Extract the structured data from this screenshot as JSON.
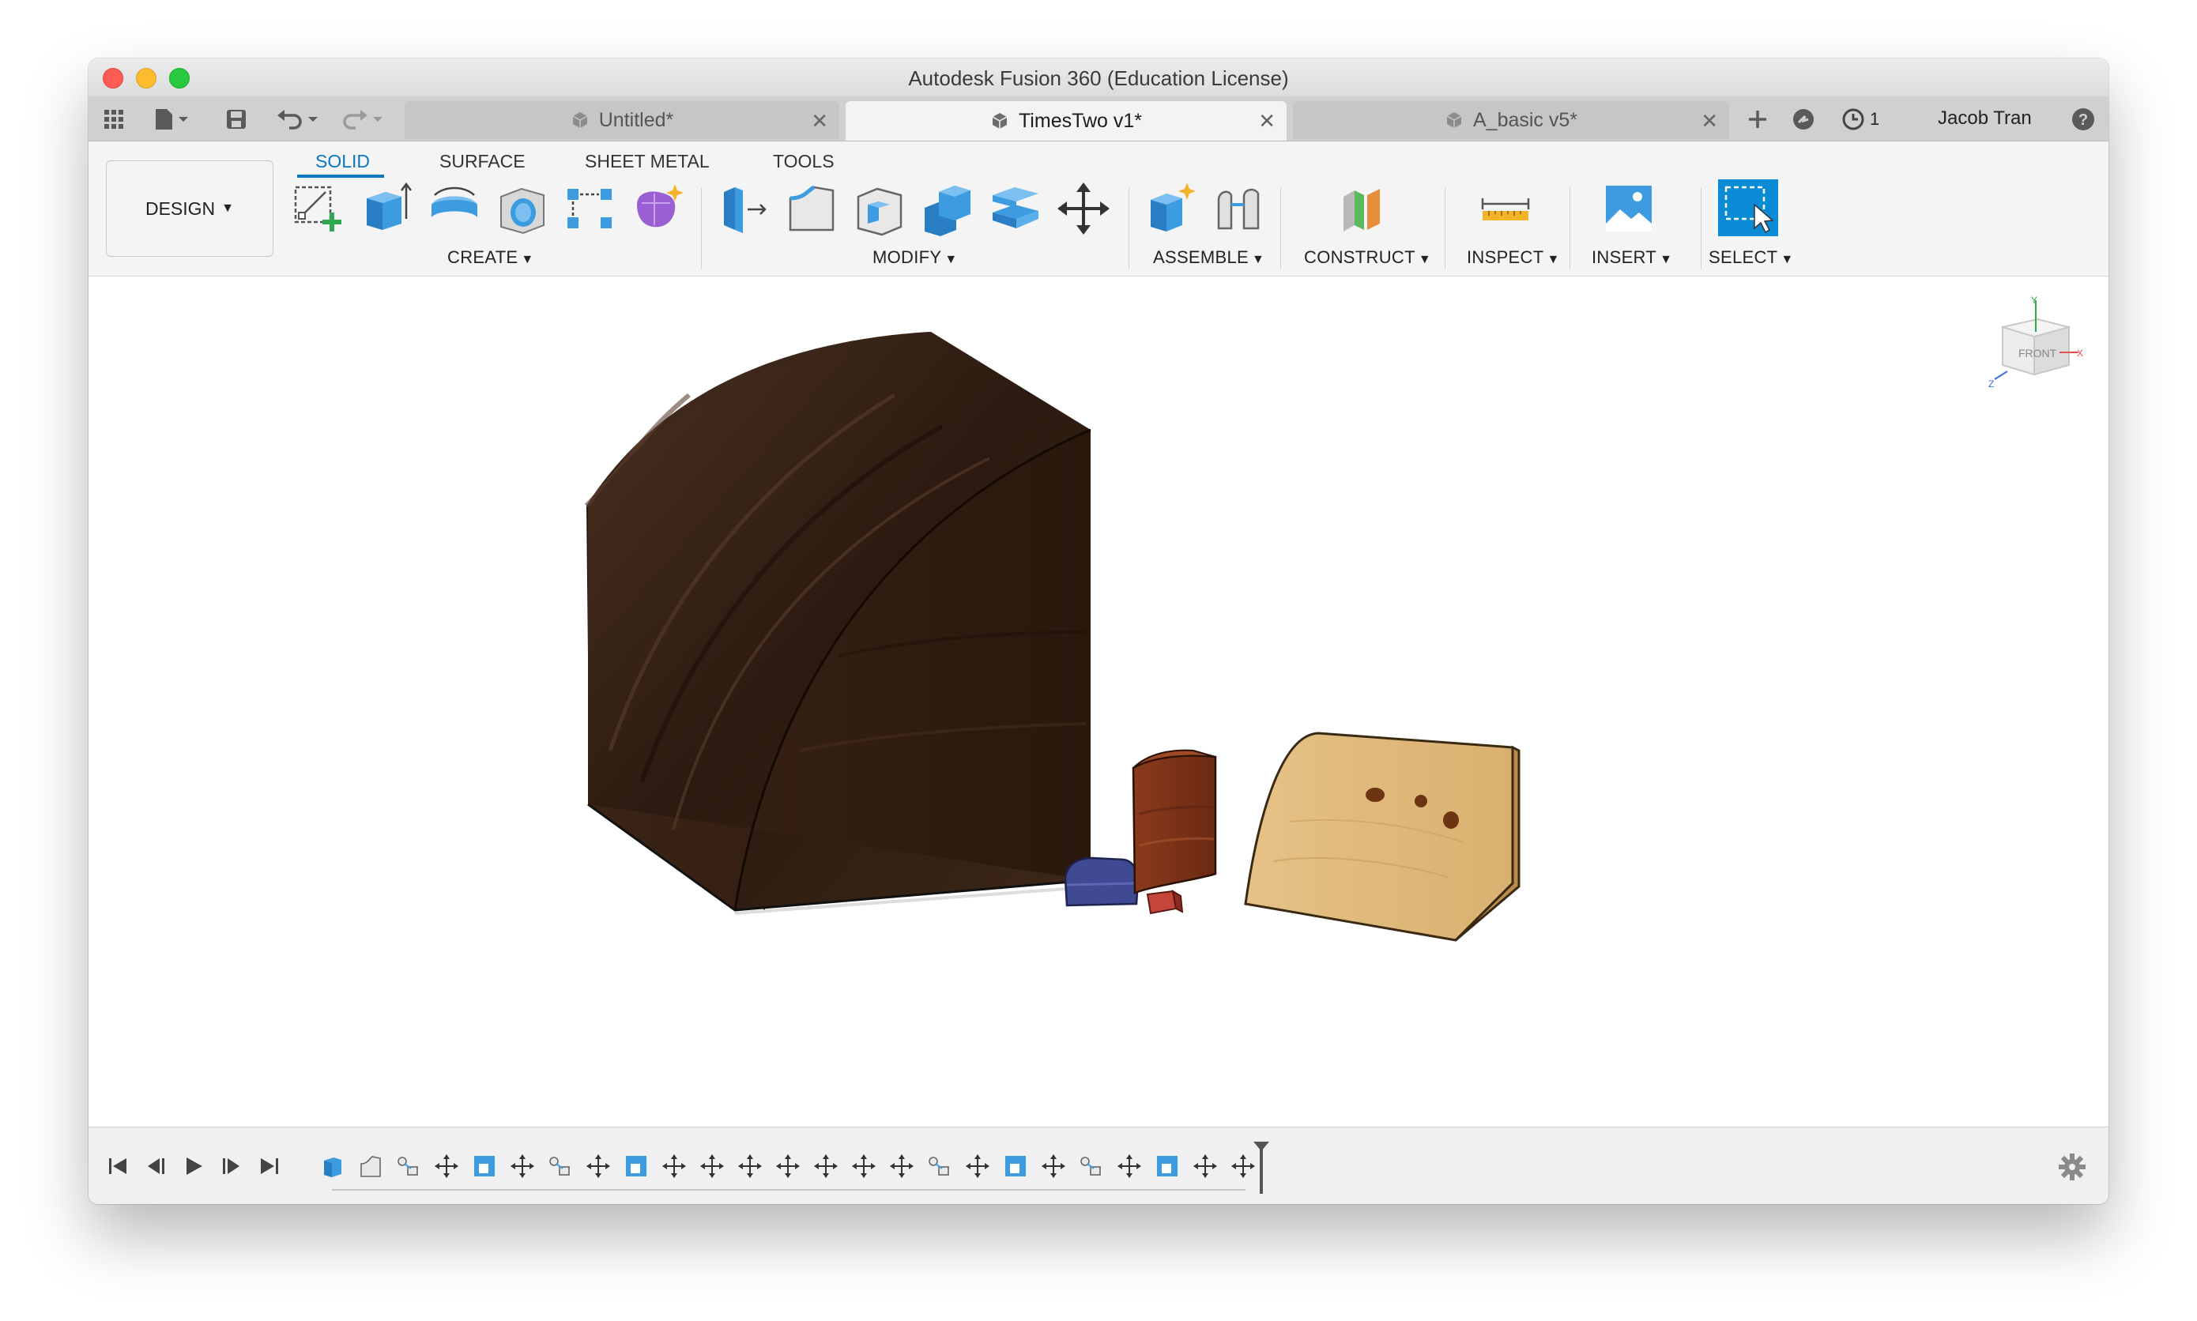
{
  "window": {
    "title": "Autodesk Fusion 360 (Education License)"
  },
  "tabs": [
    {
      "label": "Untitled*",
      "active": false
    },
    {
      "label": "TimesTwo v1*",
      "active": true
    },
    {
      "label": "A_basic v5*",
      "active": false
    }
  ],
  "topbar": {
    "jobs_count": "1",
    "user": "Jacob Tran",
    "help": "?"
  },
  "workspace": {
    "label": "DESIGN"
  },
  "ribbon_tabs": [
    "SOLID",
    "SURFACE",
    "SHEET METAL",
    "TOOLS"
  ],
  "groups": {
    "create": "CREATE",
    "modify": "MODIFY",
    "assemble": "ASSEMBLE",
    "construct": "CONSTRUCT",
    "inspect": "INSPECT",
    "insert": "INSERT",
    "select": "SELECT"
  },
  "tools": {
    "create": [
      "new-sketch-icon",
      "extrude-icon",
      "revolve-icon",
      "hole-icon",
      "pattern-icon",
      "create-form-icon"
    ],
    "modify": [
      "press-pull-icon",
      "fillet-icon",
      "shell-icon",
      "combine-icon",
      "offset-face-icon",
      "move-icon"
    ],
    "assemble": [
      "new-component-icon",
      "joint-icon"
    ],
    "construct": [
      "plane-icon"
    ],
    "inspect": [
      "measure-icon"
    ],
    "insert": [
      "insert-image-icon"
    ],
    "select": [
      "select-icon"
    ]
  },
  "viewcube": {
    "face": "FRONT",
    "axes": [
      "Y",
      "X",
      "Z"
    ]
  },
  "timeline": {
    "features": [
      "extrude",
      "fillet",
      "joint",
      "move",
      "shell",
      "move",
      "joint",
      "move",
      "shell",
      "move",
      "move",
      "move",
      "move",
      "move",
      "move",
      "move",
      "joint",
      "move",
      "shell",
      "move",
      "joint",
      "move",
      "shell",
      "move",
      "move"
    ]
  },
  "colors": {
    "accent": "#0b76c5",
    "tool_blue": "#3d9be0"
  }
}
